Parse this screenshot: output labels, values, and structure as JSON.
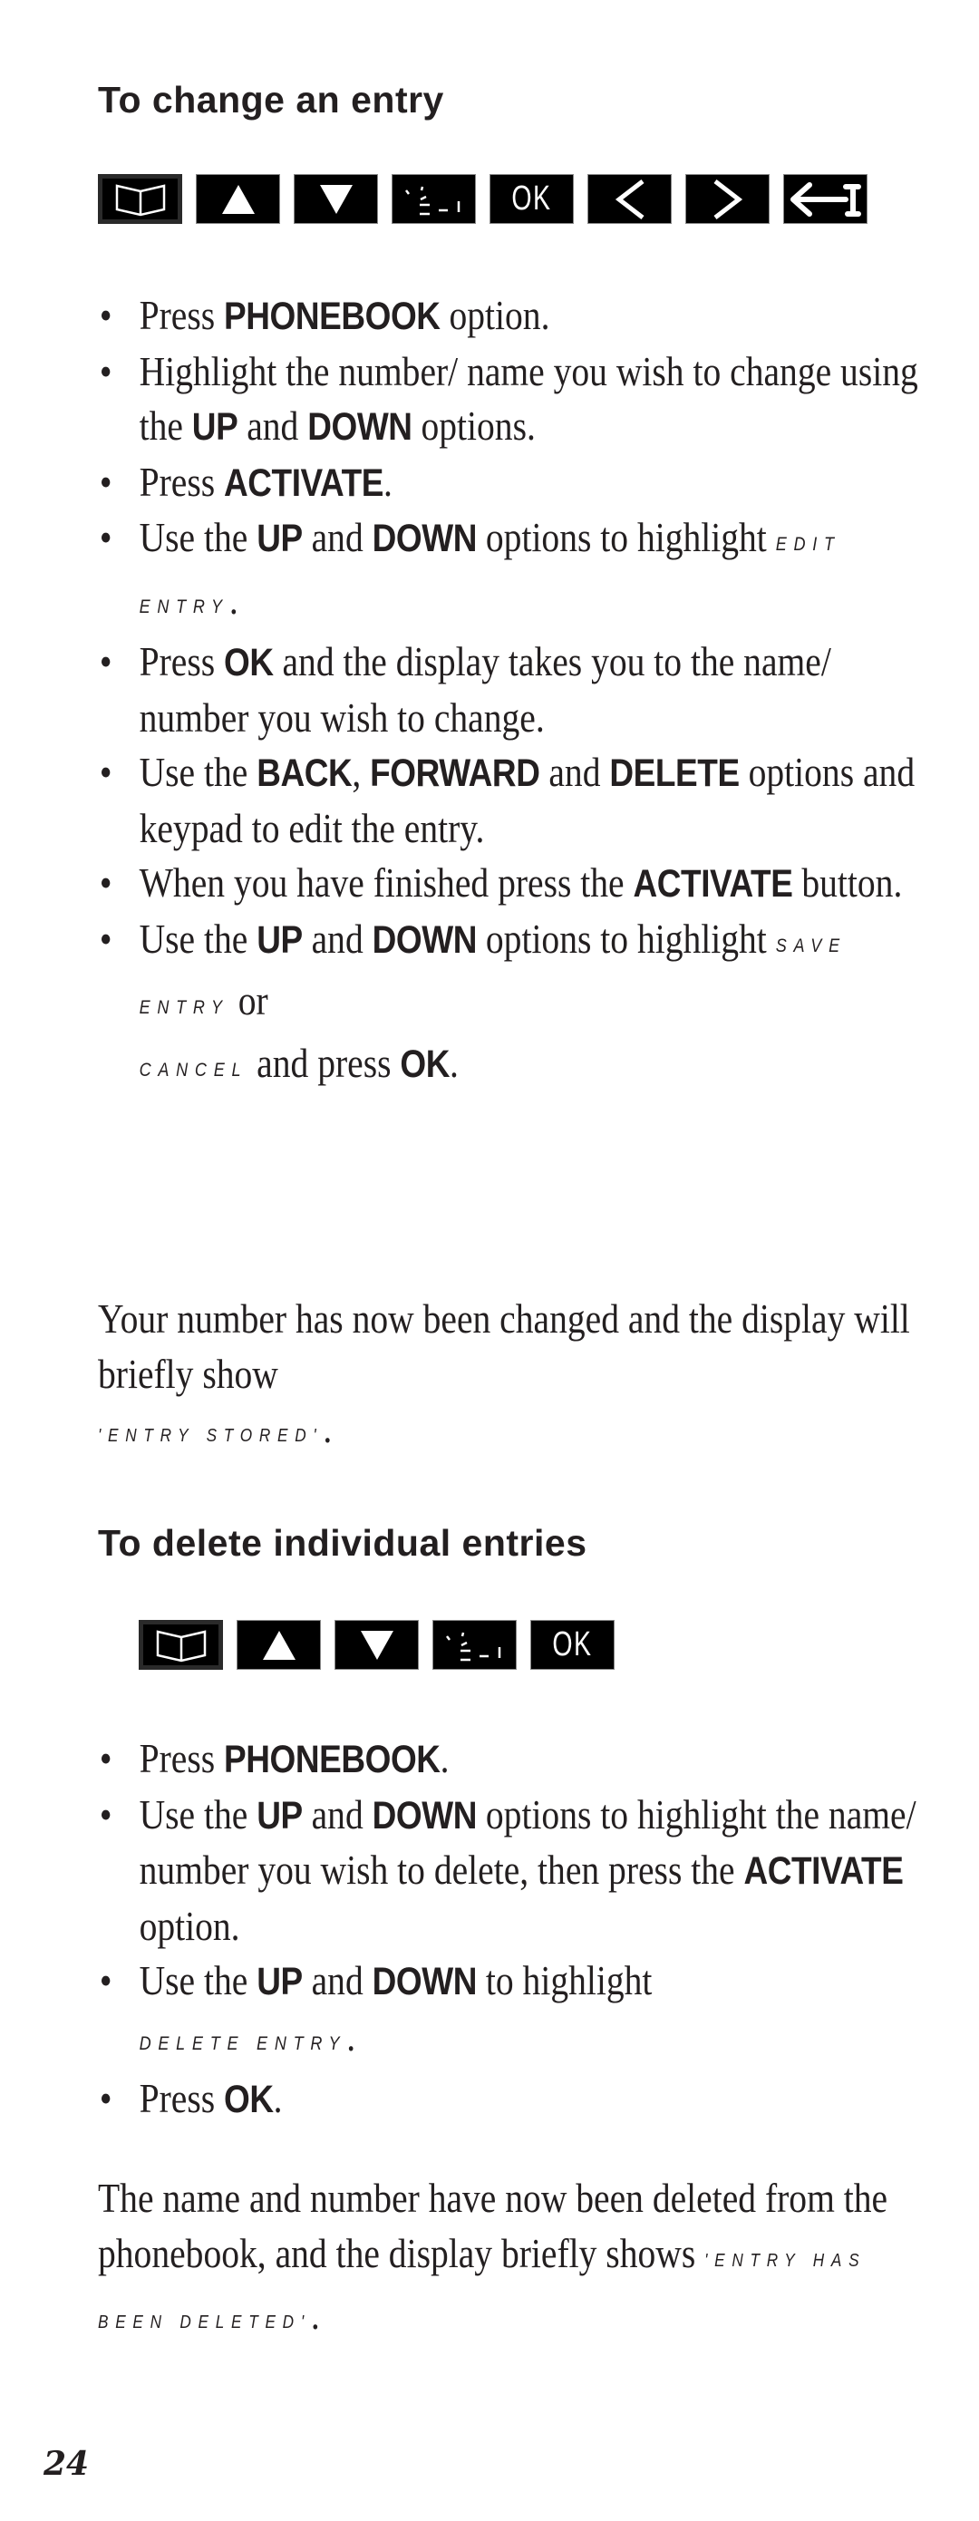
{
  "sections": [
    {
      "heading": "To change an entry",
      "keys": [
        {
          "icon": "phonebook-icon",
          "label": ""
        },
        {
          "icon": "up-arrow-icon",
          "label": ""
        },
        {
          "icon": "down-arrow-icon",
          "label": ""
        },
        {
          "icon": "activate-icon",
          "label": ""
        },
        {
          "icon": "ok-icon",
          "label": "OK"
        },
        {
          "icon": "back-icon",
          "label": ""
        },
        {
          "icon": "forward-icon",
          "label": ""
        },
        {
          "icon": "delete-icon",
          "label": ""
        }
      ],
      "steps": [
        {
          "parts": [
            {
              "t": "Press "
            },
            {
              "b": "PHONEBOOK"
            },
            {
              "t": " option."
            }
          ]
        },
        {
          "parts": [
            {
              "t": "Highlight the number/ name you wish to change using the "
            },
            {
              "b": "UP"
            },
            {
              "t": " and "
            },
            {
              "b": "DOWN"
            },
            {
              "t": " options."
            }
          ]
        },
        {
          "parts": [
            {
              "t": "Press "
            },
            {
              "b": "ACTIVATE"
            },
            {
              "t": "."
            }
          ]
        },
        {
          "parts": [
            {
              "t": "Use the "
            },
            {
              "b": "UP"
            },
            {
              "t": " and "
            },
            {
              "b": "DOWN"
            },
            {
              "t": " options to highlight "
            },
            {
              "d": "Edit Entry"
            },
            {
              "t": "."
            }
          ]
        },
        {
          "parts": [
            {
              "t": "Press "
            },
            {
              "b": "OK"
            },
            {
              "t": " and the display takes you to the name/ number you wish to change."
            }
          ]
        },
        {
          "parts": [
            {
              "t": "Use the "
            },
            {
              "b": "BACK"
            },
            {
              "t": ", "
            },
            {
              "b": "FORWARD"
            },
            {
              "t": " and "
            },
            {
              "b": "DELETE"
            },
            {
              "t": " options and keypad to edit the entry."
            }
          ]
        },
        {
          "parts": [
            {
              "t": "When you have finished press the "
            },
            {
              "b": "ACTIVATE"
            },
            {
              "t": " button."
            }
          ]
        },
        {
          "parts": [
            {
              "t": "Use the "
            },
            {
              "b": "UP"
            },
            {
              "t": " and "
            },
            {
              "b": "DOWN"
            },
            {
              "t": " options to highlight "
            },
            {
              "d": "Save Entry"
            },
            {
              "t": " or "
            },
            {
              "br": true
            },
            {
              "d": "Cancel"
            },
            {
              "t": " and press "
            },
            {
              "b": "OK"
            },
            {
              "t": "."
            }
          ]
        }
      ],
      "result": {
        "text": "Your number has now been changed and the display will briefly show",
        "display_message": "'Entry Stored'",
        "suffix": "."
      }
    },
    {
      "heading": "To delete individual entries",
      "keys": [
        {
          "icon": "phonebook-icon",
          "label": ""
        },
        {
          "icon": "up-arrow-icon",
          "label": ""
        },
        {
          "icon": "down-arrow-icon",
          "label": ""
        },
        {
          "icon": "activate-icon",
          "label": ""
        },
        {
          "icon": "ok-icon",
          "label": "OK"
        }
      ],
      "steps": [
        {
          "parts": [
            {
              "t": "Press "
            },
            {
              "b": "PHONEBOOK"
            },
            {
              "t": "."
            }
          ]
        },
        {
          "parts": [
            {
              "t": "Use the "
            },
            {
              "b": "UP"
            },
            {
              "t": " and "
            },
            {
              "b": "DOWN"
            },
            {
              "t": " options to highlight the name/ number you wish to delete, then press the "
            },
            {
              "b": "ACTIVATE"
            },
            {
              "t": " option."
            }
          ]
        },
        {
          "parts": [
            {
              "t": "Use the "
            },
            {
              "b": "UP"
            },
            {
              "t": " and "
            },
            {
              "b": "DOWN"
            },
            {
              "t": " to highlight "
            },
            {
              "br": true
            },
            {
              "d": "Delete Entry"
            },
            {
              "t": "."
            }
          ]
        },
        {
          "parts": [
            {
              "t": "Press "
            },
            {
              "b": "OK"
            },
            {
              "t": "."
            }
          ]
        }
      ],
      "result": {
        "text": "The name and number have now been deleted from the phonebook, and the display briefly shows",
        "display_message": "'Entry has been deleted'",
        "suffix": "."
      }
    }
  ],
  "footer": {
    "page_number": "24"
  }
}
